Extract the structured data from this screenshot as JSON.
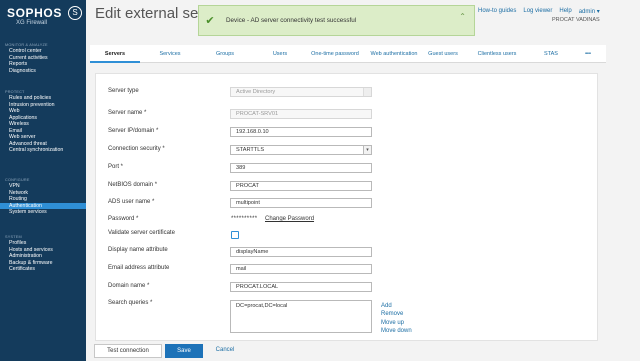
{
  "brand": {
    "name": "SOPHOS",
    "product": "XG Firewall"
  },
  "sidebar": {
    "sections": [
      {
        "title": "MONITOR & ANALYZE",
        "items": [
          "Control center",
          "Current activities",
          "Reports",
          "Diagnostics"
        ]
      },
      {
        "title": "PROTECT",
        "items": [
          "Rules and policies",
          "Intrusion prevention",
          "Web",
          "Applications",
          "Wireless",
          "Email",
          "Web server",
          "Advanced threat",
          "Central synchronization"
        ]
      },
      {
        "title": "CONFIGURE",
        "items": [
          "VPN",
          "Network",
          "Routing",
          "Authentication",
          "System services"
        ]
      },
      {
        "title": "SYSTEM",
        "items": [
          "Profiles",
          "Hosts and services",
          "Administration",
          "Backup & firmware",
          "Certificates"
        ]
      }
    ],
    "active_item": "Authentication"
  },
  "header": {
    "title": "Edit external server",
    "links": [
      "How-to guides",
      "Log viewer",
      "Help",
      "admin ▾"
    ],
    "device": "PROCAT VADINAS"
  },
  "toast": {
    "message": "Device - AD server connectivity test successful"
  },
  "tabs": [
    "Servers",
    "Services",
    "Groups",
    "Users",
    "One-time password",
    "Web authentication",
    "Guest users",
    "Clientless users",
    "STAS",
    "•••"
  ],
  "form": {
    "server_type": {
      "label": "Server type",
      "value": "Active Directory"
    },
    "server_name": {
      "label": "Server name *",
      "value": "PROCAT-SRV01"
    },
    "server_ip": {
      "label": "Server IP/domain *",
      "value": "192.168.0.10"
    },
    "connection_security": {
      "label": "Connection security *",
      "value": "STARTTLS"
    },
    "port": {
      "label": "Port *",
      "value": "389"
    },
    "netbios": {
      "label": "NetBIOS domain *",
      "value": "PROCAT"
    },
    "ads_user": {
      "label": "ADS user name *",
      "value": "multipoint"
    },
    "password": {
      "label": "Password *",
      "mask": "**********",
      "change_label": "Change Password"
    },
    "validate_cert": {
      "label": "Validate server certificate"
    },
    "display_name_attr": {
      "label": "Display name attribute",
      "value": "displayName"
    },
    "email_attr": {
      "label": "Email address attribute",
      "value": "mail"
    },
    "domain_name": {
      "label": "Domain name *",
      "value": "PROCAT.LOCAL"
    },
    "search_queries": {
      "label": "Search queries *",
      "value": "DC=procat,DC=local",
      "actions": [
        "Add",
        "Remove",
        "Move up",
        "Move down"
      ]
    }
  },
  "footer": {
    "test_label": "Test connection",
    "save_label": "Save",
    "cancel_label": "Cancel"
  }
}
